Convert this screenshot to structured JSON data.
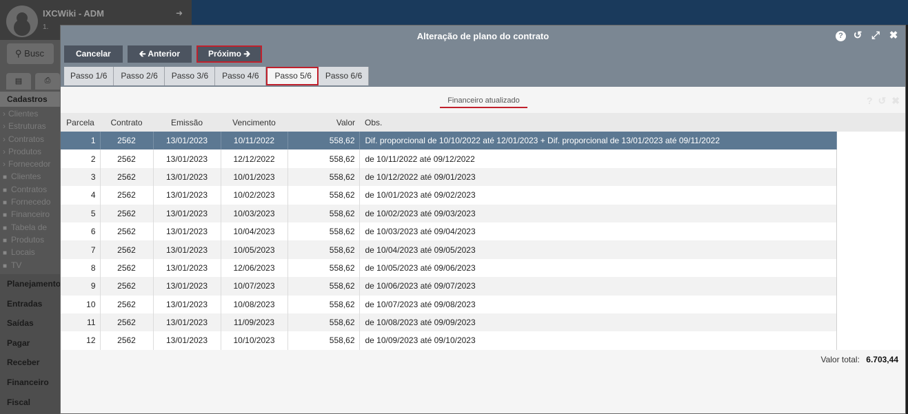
{
  "app": {
    "title": "IXCWiki - ADM",
    "subtitle": "1.",
    "search_placeholder": "Busc",
    "sidebar_section": "Cadastros",
    "sidebar_items": [
      {
        "label": "Clientes",
        "kind": "arrow"
      },
      {
        "label": "Estruturas",
        "kind": "arrow"
      },
      {
        "label": "Contratos",
        "kind": "arrow"
      },
      {
        "label": "Produtos",
        "kind": "arrow"
      },
      {
        "label": "Fornecedor",
        "kind": "arrow"
      },
      {
        "label": "Clientes",
        "kind": "folder"
      },
      {
        "label": "Contratos",
        "kind": "folder"
      },
      {
        "label": "Fornecedo",
        "kind": "folder"
      },
      {
        "label": "Financeiro",
        "kind": "folder"
      },
      {
        "label": "Tabela de",
        "kind": "folder"
      },
      {
        "label": "Produtos",
        "kind": "folder"
      },
      {
        "label": "Locais",
        "kind": "folder"
      },
      {
        "label": "TV",
        "kind": "folder"
      }
    ],
    "sidebar_menu": [
      "Planejamento",
      "Entradas",
      "Saídas",
      "Pagar",
      "Receber",
      "Financeiro",
      "Fiscal"
    ]
  },
  "modal": {
    "title": "Alteração de plano do contrato",
    "buttons": {
      "cancel": "Cancelar",
      "previous": "Anterior",
      "next": "Próximo"
    },
    "steps": [
      "Passo 1/6",
      "Passo 2/6",
      "Passo 3/6",
      "Passo 4/6",
      "Passo 5/6",
      "Passo 6/6"
    ],
    "current_step": 5,
    "content_tab": "Financeiro atualizado",
    "table": {
      "headers": [
        "Parcela",
        "Contrato",
        "Emissão",
        "Vencimento",
        "Valor",
        "Obs."
      ],
      "rows": [
        [
          "1",
          "2562",
          "13/01/2023",
          "10/11/2022",
          "558,62",
          "Dif. proporcional de 10/10/2022 até 12/01/2023 + Dif. proporcional de 13/01/2023 até 09/11/2022"
        ],
        [
          "2",
          "2562",
          "13/01/2023",
          "12/12/2022",
          "558,62",
          "de 10/11/2022 até 09/12/2022"
        ],
        [
          "3",
          "2562",
          "13/01/2023",
          "10/01/2023",
          "558,62",
          "de 10/12/2022 até 09/01/2023"
        ],
        [
          "4",
          "2562",
          "13/01/2023",
          "10/02/2023",
          "558,62",
          "de 10/01/2023 até 09/02/2023"
        ],
        [
          "5",
          "2562",
          "13/01/2023",
          "10/03/2023",
          "558,62",
          "de 10/02/2023 até 09/03/2023"
        ],
        [
          "6",
          "2562",
          "13/01/2023",
          "10/04/2023",
          "558,62",
          "de 10/03/2023 até 09/04/2023"
        ],
        [
          "7",
          "2562",
          "13/01/2023",
          "10/05/2023",
          "558,62",
          "de 10/04/2023 até 09/05/2023"
        ],
        [
          "8",
          "2562",
          "13/01/2023",
          "12/06/2023",
          "558,62",
          "de 10/05/2023 até 09/06/2023"
        ],
        [
          "9",
          "2562",
          "13/01/2023",
          "10/07/2023",
          "558,62",
          "de 10/06/2023 até 09/07/2023"
        ],
        [
          "10",
          "2562",
          "13/01/2023",
          "10/08/2023",
          "558,62",
          "de 10/07/2023 até 09/08/2023"
        ],
        [
          "11",
          "2562",
          "13/01/2023",
          "11/09/2023",
          "558,62",
          "de 10/08/2023 até 09/09/2023"
        ],
        [
          "12",
          "2562",
          "13/01/2023",
          "10/10/2023",
          "558,62",
          "de 10/09/2023 até 09/10/2023"
        ]
      ],
      "selected_row": 1
    },
    "total_label": "Valor total:",
    "total_value": "6.703,44"
  },
  "colors": {
    "header": "#7b8793",
    "button": "#4c5460",
    "accent_red": "#c0202c",
    "selected_row": "#5c7892"
  }
}
